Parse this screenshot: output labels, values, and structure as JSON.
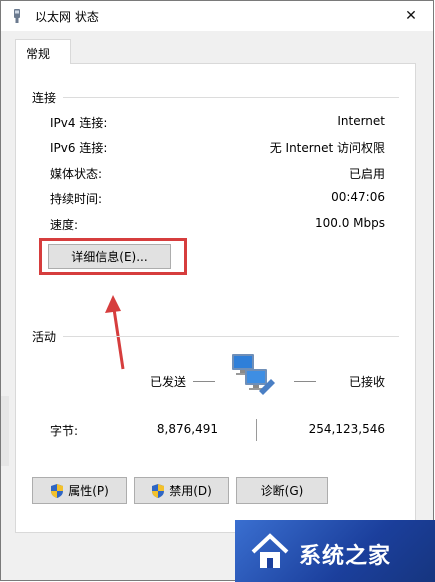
{
  "window": {
    "title": "以太网 状态",
    "close_label": "✕"
  },
  "tabs": [
    {
      "label": "常规"
    }
  ],
  "connection": {
    "group_label": "连接",
    "rows": [
      {
        "label": "IPv4 连接:",
        "value": "Internet"
      },
      {
        "label": "IPv6 连接:",
        "value": "无 Internet 访问权限"
      },
      {
        "label": "媒体状态:",
        "value": "已启用"
      },
      {
        "label": "持续时间:",
        "value": "00:47:06"
      },
      {
        "label": "速度:",
        "value": "100.0 Mbps"
      }
    ],
    "details_button": "详细信息(E)..."
  },
  "activity": {
    "group_label": "活动",
    "sent_label": "已发送",
    "received_label": "已接收",
    "bytes_label": "字节:",
    "bytes_sent": "8,876,491",
    "bytes_received": "254,123,546"
  },
  "buttons": {
    "properties": "属性(P)",
    "disable": "禁用(D)",
    "diagnose": "诊断(G)"
  },
  "watermark": {
    "text": "系统之家"
  },
  "icons": {
    "title": "network-adapter-icon",
    "network": "network-computers-icon",
    "shield": "uac-shield-icon",
    "arrow": "red-arrow-annotation"
  },
  "colors": {
    "highlight": "#d63d3d",
    "accent": "#1b5fbf"
  }
}
